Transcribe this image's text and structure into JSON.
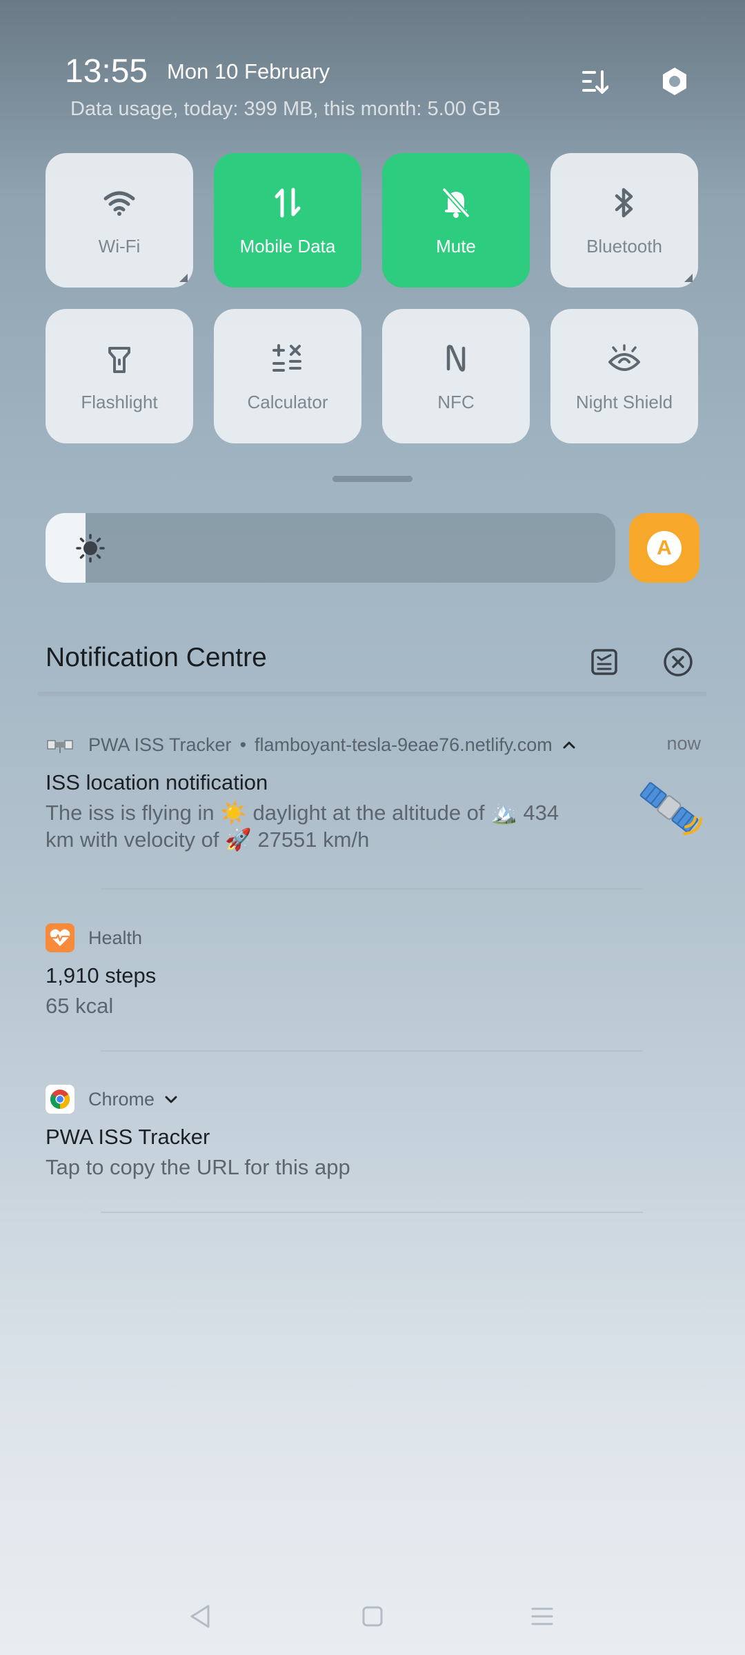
{
  "status": {
    "time": "13:55",
    "date": "Mon 10 February",
    "data_usage": "Data usage, today: 399 MB, this month: 5.00 GB"
  },
  "header_icons": {
    "edit": "edit-tiles-icon",
    "settings": "settings-icon"
  },
  "tiles": [
    {
      "label": "Wi-Fi",
      "icon": "wifi-icon",
      "active": false
    },
    {
      "label": "Mobile Data",
      "icon": "mobile-data-icon",
      "active": true
    },
    {
      "label": "Mute",
      "icon": "mute-bell-icon",
      "active": true
    },
    {
      "label": "Bluetooth",
      "icon": "bluetooth-icon",
      "active": false
    },
    {
      "label": "Flashlight",
      "icon": "flashlight-icon",
      "active": false
    },
    {
      "label": "Calculator",
      "icon": "calculator-icon",
      "active": false
    },
    {
      "label": "NFC",
      "icon": "nfc-icon",
      "active": false
    },
    {
      "label": "Night Shield",
      "icon": "eye-icon",
      "active": false
    }
  ],
  "brightness": {
    "level": 0.07,
    "auto_label": "A"
  },
  "notification_centre": {
    "title": "Notification Centre"
  },
  "notifications": [
    {
      "app": "PWA ISS Tracker",
      "separator": "•",
      "source": "flamboyant-tesla-9eae76.netlify.com",
      "time": "now",
      "title": "ISS location notification",
      "body_line1": "The iss is flying in ☀️ daylight at the altitude of 🏔️ 434",
      "body_line2": "km with velocity of 🚀 27551 km/h",
      "thumbnail": "satellite-icon"
    },
    {
      "app": "Health",
      "title": "1,910 steps",
      "body": "65 kcal"
    },
    {
      "app": "Chrome",
      "title": "PWA ISS Tracker",
      "body": "Tap to copy the URL for this app"
    }
  ],
  "colors": {
    "active_tile": "#2ecc7f",
    "auto_brightness": "#f7a72a"
  }
}
